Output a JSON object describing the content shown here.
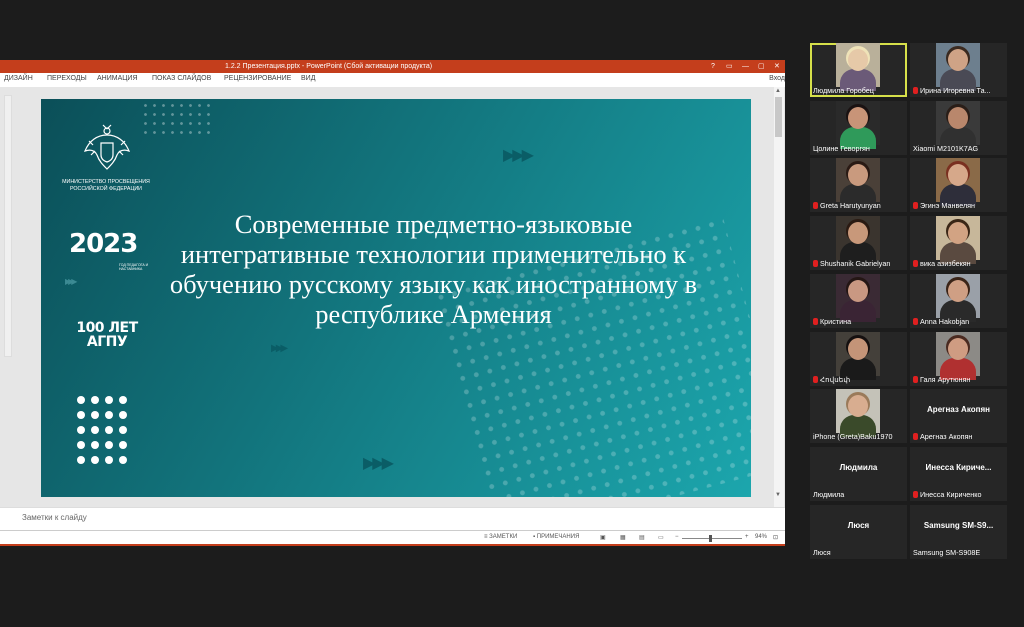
{
  "powerpoint": {
    "title": "1.2.2 Презентация.pptx - PowerPoint (Сбой активации продукта)",
    "window_controls": [
      "?",
      "▭",
      "—",
      "▢",
      "✕"
    ],
    "ribbon_tabs": [
      "ДИЗАЙН",
      "ПЕРЕХОДЫ",
      "АНИМАЦИЯ",
      "ПОКАЗ СЛАЙДОВ",
      "РЕЦЕНЗИРОВАНИЕ",
      "ВИД"
    ],
    "ribbon_right": "Вход",
    "notes_placeholder": "Заметки к слайду",
    "status": {
      "notes": "ЗАМЕТКИ",
      "comments": "ПРИМЕЧАНИЯ",
      "zoom_minus": "−",
      "zoom_plus": "+",
      "zoom": "94%",
      "zoom_fraction": 0.47
    }
  },
  "slide": {
    "ministry": "МИНИСТЕРСТВО ПРОСВЕЩЕНИЯ РОССИЙСКОЙ ФЕДЕРАЦИИ",
    "year_logo": "2023",
    "year_logo_caption": "ГОД ПЕДАГОГА И НАСТАВНИКА",
    "anniversary_line1": "100 ЛЕТ",
    "anniversary_line2": "АГПУ",
    "title": "Современные предметно-языковые интегративные технологии применительно к обучению русскому языку как иностранному в республике Армения",
    "colors": {
      "bg_dark": "#0b4f58",
      "bg_light": "#1ca6ad"
    }
  },
  "participants": [
    {
      "name": "Людмила Горобец",
      "muted": false,
      "video": true,
      "active": true,
      "bg": "#b9b09a",
      "face": "#e6c9a8",
      "hair": "#efe3b8",
      "shirt": "#6b5a78"
    },
    {
      "name": "Ирина Игоревна Та...",
      "muted": true,
      "video": true,
      "active": false,
      "bg": "#6d7f8e",
      "face": "#cfa386",
      "hair": "#3a2a20",
      "shirt": "#4a4a55"
    },
    {
      "name": "Цолине Геворгян",
      "muted": false,
      "video": true,
      "active": false,
      "bg": "#2a2a2a",
      "face": "#c89478",
      "hair": "#1a1212",
      "shirt": "#2f9a5a"
    },
    {
      "name": "Xiaomi M2101K7AG",
      "muted": false,
      "video": true,
      "active": false,
      "bg": "#3a3a3a",
      "face": "#b9876c",
      "hair": "#2a1e18",
      "shirt": "#303030"
    },
    {
      "name": "Greta Harutyunyan",
      "muted": true,
      "video": true,
      "active": false,
      "bg": "#4a4038",
      "face": "#c99a7e",
      "hair": "#2a1a14",
      "shirt": "#2b2b2b"
    },
    {
      "name": "Эгинэ Манвелян",
      "muted": true,
      "video": true,
      "active": false,
      "bg": "#8a6a48",
      "face": "#d6a88a",
      "hair": "#7a3020",
      "shirt": "#2e2e3a"
    },
    {
      "name": "Shushanik Gabrielyan",
      "muted": true,
      "video": true,
      "active": false,
      "bg": "#3a342e",
      "face": "#c8987a",
      "hair": "#2a1a12",
      "shirt": "#1e1e1e"
    },
    {
      "name": "вика азизбекян",
      "muted": true,
      "video": true,
      "active": false,
      "bg": "#c7b79a",
      "face": "#d2a383",
      "hair": "#3a2616",
      "shirt": "#5a4a40"
    },
    {
      "name": "Кристина",
      "muted": true,
      "video": true,
      "active": false,
      "bg": "#3a2a34",
      "face": "#c99882",
      "hair": "#241614",
      "shirt": "#3a2434"
    },
    {
      "name": "Anna Hakobjan",
      "muted": true,
      "video": true,
      "active": false,
      "bg": "#9aa0a8",
      "face": "#cf9f84",
      "hair": "#3a2418",
      "shirt": "#2a2a2a"
    },
    {
      "name": "Հովսեփ",
      "muted": true,
      "video": true,
      "active": false,
      "bg": "#44403a",
      "face": "#c49478",
      "hair": "#151010",
      "shirt": "#1a1a1a"
    },
    {
      "name": "Галя Арутюнян",
      "muted": true,
      "video": true,
      "active": false,
      "bg": "#8c8a86",
      "face": "#cf9c82",
      "hair": "#4a2a20",
      "shirt": "#b03030"
    },
    {
      "name": "iPhone (Greta)Baku1970",
      "muted": false,
      "video": true,
      "active": false,
      "bg": "#c4c2b8",
      "face": "#d8ad90",
      "hair": "#9a7a5a",
      "shirt": "#3a4a2a"
    },
    {
      "name": "Арегназ Акопян",
      "display": "Арегназ Акопян",
      "muted": true,
      "video": false,
      "active": false
    },
    {
      "name": "Людмила",
      "display": "Людмила",
      "muted": false,
      "video": false,
      "active": false
    },
    {
      "name": "Инесса Кириченко",
      "display": "Инесса Киричe...",
      "muted": true,
      "video": false,
      "active": false
    },
    {
      "name": "Люся",
      "display": "Люся",
      "muted": false,
      "video": false,
      "active": false
    },
    {
      "name": "Samsung SM-S908E",
      "display": "Samsung SM-S9...",
      "muted": false,
      "video": false,
      "active": false
    }
  ]
}
